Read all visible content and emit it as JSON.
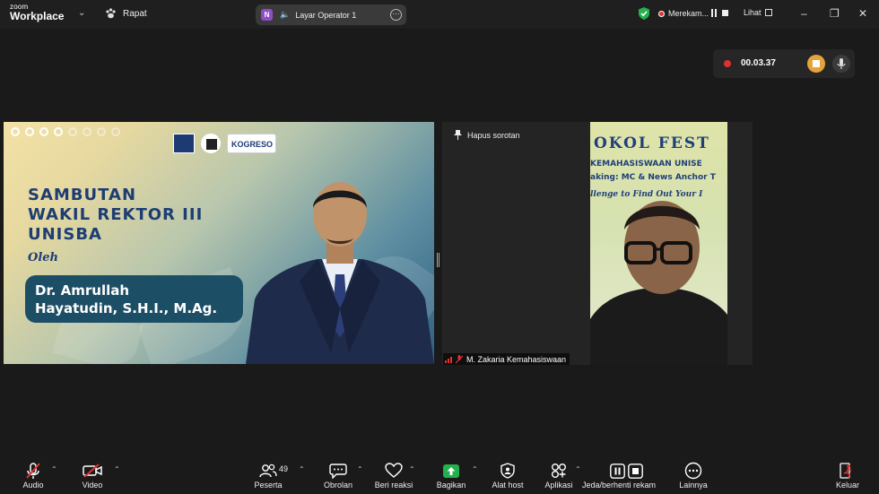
{
  "titlebar": {
    "brand_small": "zoom",
    "brand_big": "Workplace",
    "meeting_label": "Rapat",
    "screen_share_badge": "N",
    "screen_share_label": "Layar Operator 1",
    "recording_label": "Merekam...",
    "view_label": "Lihat",
    "icons": [
      "chevron-down-icon",
      "paw-icon",
      "speaker-icon",
      "more-icon",
      "shield-check-icon",
      "pause-icon",
      "stop-icon",
      "grid-icon",
      "minimize-icon",
      "restore-icon",
      "close-icon"
    ]
  },
  "recording": {
    "time": "00.03.37"
  },
  "slide": {
    "title": "SAMBUTAN\nWAKIL REKTOR III\nUNISBA",
    "by": "Oleh",
    "speaker": "Dr. Amrullah\nHayatudin, S.H.I., M.Ag.",
    "logo_text": "K",
    "logo_text2": "OGRESO"
  },
  "camera": {
    "spotlight_label": "Hapus sorotan",
    "participant_name": "M. Zakaria Kemahasiswaan",
    "banner_line1": "OKOL FEST",
    "banner_line2": "KEMAHASISWAAN UNISE",
    "banner_line3": "aking: MC & News Anchor T",
    "banner_line4": "llenge to Find Out Your I"
  },
  "toolbar": {
    "audio": "Audio",
    "video": "Video",
    "participants": "Peserta",
    "participants_count": "49",
    "chat": "Obrolan",
    "reactions": "Beri reaksi",
    "share": "Bagikan",
    "host_tools": "Alat host",
    "apps": "Aplikasi",
    "record": "Jeda/berhenti rekam",
    "more": "Lainnya",
    "leave": "Keluar"
  },
  "colors": {
    "record_red": "#e03131",
    "share_green": "#22b14c",
    "slide_navy": "#1d3d74",
    "stop_orange": "#e6a33c"
  }
}
